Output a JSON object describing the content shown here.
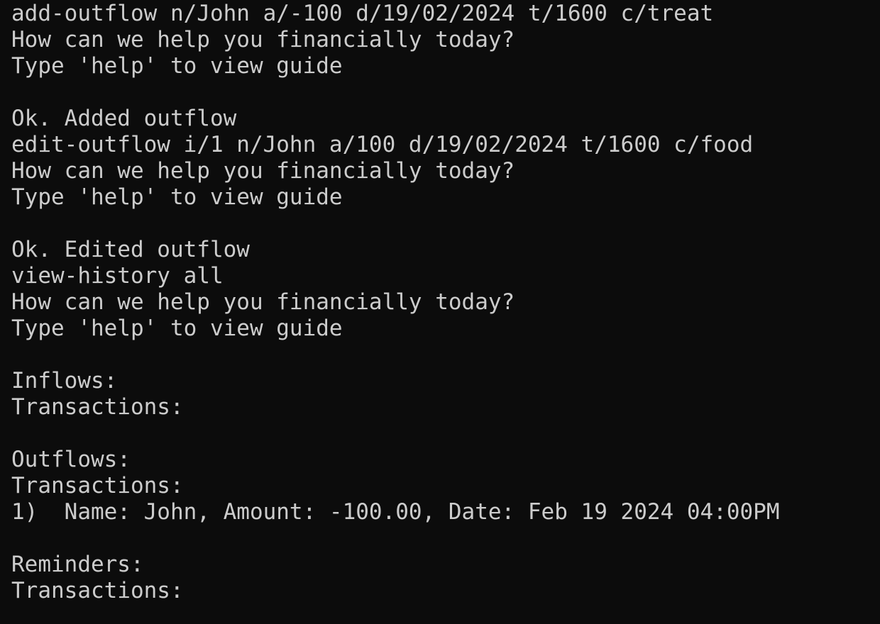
{
  "terminal": {
    "lines": [
      "add-outflow n/John a/-100 d/19/02/2024 t/1600 c/treat",
      "How can we help you financially today?",
      "Type 'help' to view guide",
      "",
      "Ok. Added outflow",
      "edit-outflow i/1 n/John a/100 d/19/02/2024 t/1600 c/food",
      "How can we help you financially today?",
      "Type 'help' to view guide",
      "",
      "Ok. Edited outflow",
      "view-history all",
      "How can we help you financially today?",
      "Type 'help' to view guide",
      "",
      "Inflows:",
      "Transactions:",
      "",
      "Outflows:",
      "Transactions:",
      "1)  Name: John, Amount: -100.00, Date: Feb 19 2024 04:00PM",
      "",
      "Reminders:",
      "Transactions:"
    ]
  }
}
